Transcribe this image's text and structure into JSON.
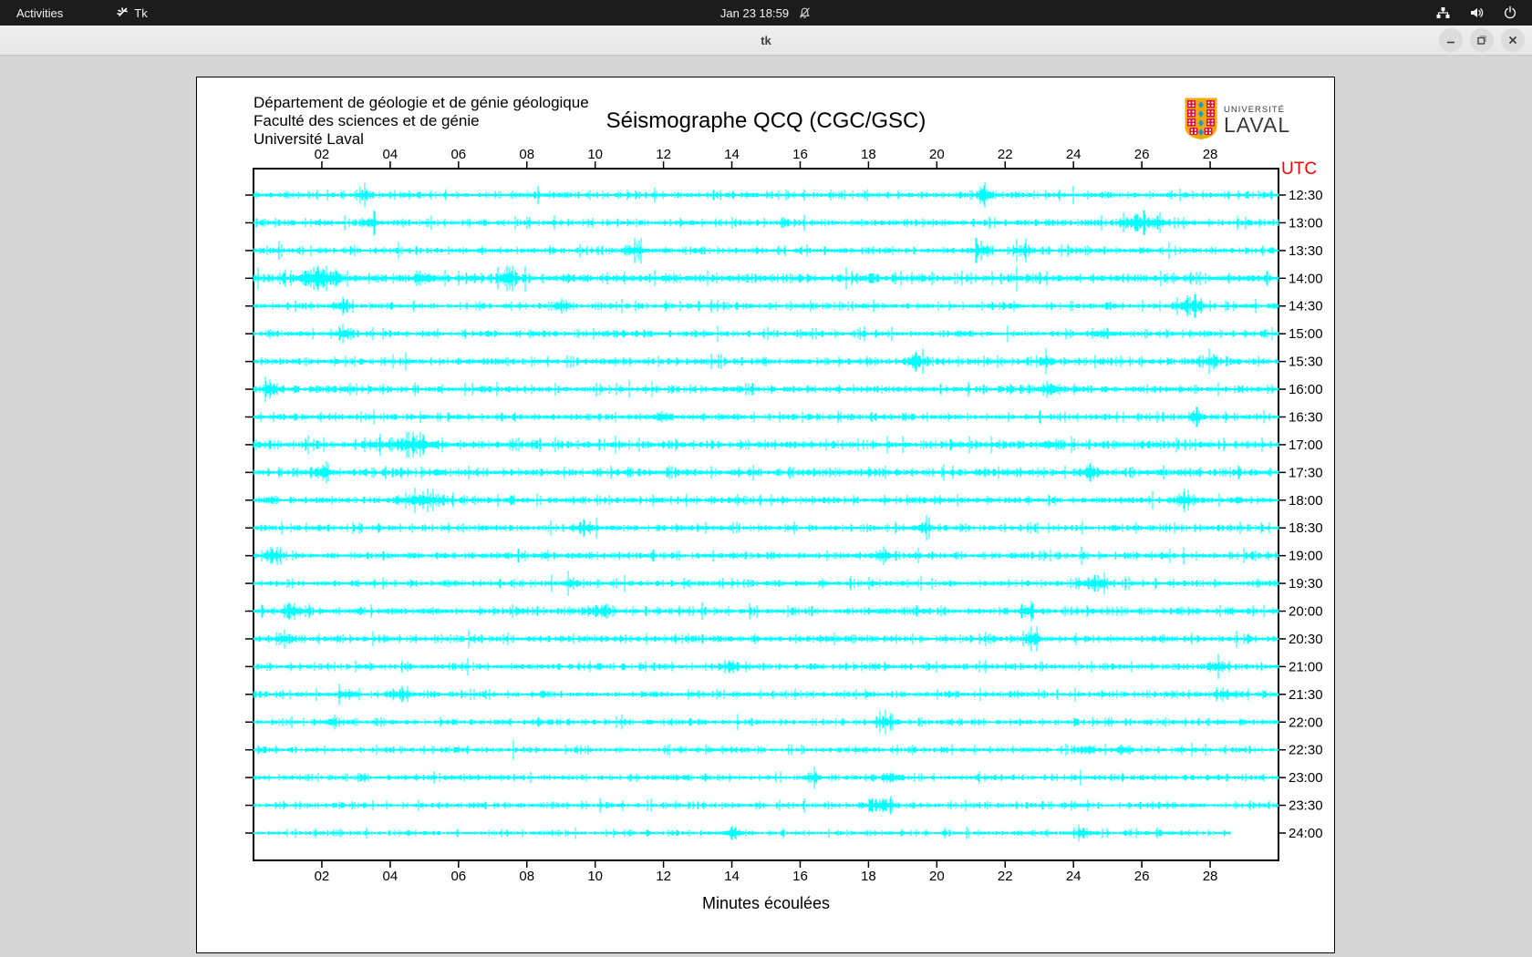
{
  "top_bar": {
    "activities_label": "Activities",
    "app_label": "Tk",
    "clock": "Jan 23 18:59",
    "icons": [
      "tk-feather-icon",
      "bell-muted-icon",
      "network-icon",
      "volume-icon",
      "power-icon"
    ]
  },
  "window": {
    "title": "tk",
    "controls": [
      "minimize",
      "maximize",
      "close"
    ]
  },
  "seismograph": {
    "header_lines": [
      "Département de géologie et de génie géologique",
      "Faculté des sciences et de génie",
      "Université Laval"
    ],
    "title": "Séismographe QCQ (CGC/GSC)",
    "logo": {
      "text_top": "UNIVERSITÉ",
      "text_bottom": "LAVAL"
    },
    "utc_label": "UTC",
    "xlabel": "Minutes écoulées",
    "chart_data": {
      "type": "seismogram",
      "trace_color": "#00ffff",
      "axis_color": "#000000",
      "x_ticks": [
        "02",
        "04",
        "06",
        "08",
        "10",
        "12",
        "14",
        "16",
        "18",
        "20",
        "22",
        "24",
        "26",
        "28"
      ],
      "x_range_minutes": [
        0,
        30
      ],
      "rows": [
        {
          "label": "12:30",
          "end_min": 30,
          "base": 1.0,
          "bursts": [
            {
              "m": 3.2,
              "g": 1.2
            },
            {
              "m": 21.4,
              "g": 3.5,
              "w": 0.18
            }
          ]
        },
        {
          "label": "13:00",
          "end_min": 30,
          "base": 1.0,
          "bursts": [
            {
              "m": 3.4,
              "g": 1.8
            },
            {
              "m": 25.9,
              "g": 2.4,
              "w": 0.35
            },
            {
              "m": 26.5,
              "g": 1.6
            }
          ]
        },
        {
          "label": "13:30",
          "end_min": 30,
          "base": 1.0,
          "bursts": [
            {
              "m": 11.2,
              "g": 2.0
            },
            {
              "m": 21.3,
              "g": 1.7
            },
            {
              "m": 22.5,
              "g": 1.5
            }
          ]
        },
        {
          "label": "14:00",
          "end_min": 30,
          "base": 1.4,
          "bursts": [
            {
              "m": 1.9,
              "g": 2.4,
              "w": 0.5
            },
            {
              "m": 5.0,
              "g": 1.4
            },
            {
              "m": 7.4,
              "g": 1.7
            }
          ]
        },
        {
          "label": "14:30",
          "end_min": 30,
          "base": 1.0,
          "bursts": [
            {
              "m": 2.6,
              "g": 1.5
            },
            {
              "m": 9.0,
              "g": 1.4
            },
            {
              "m": 27.4,
              "g": 2.3,
              "w": 0.4
            }
          ]
        },
        {
          "label": "15:00",
          "end_min": 30,
          "base": 1.0,
          "bursts": [
            {
              "m": 2.6,
              "g": 1.7
            },
            {
              "m": 24.8,
              "g": 1.3
            }
          ]
        },
        {
          "label": "15:30",
          "end_min": 30,
          "base": 1.1,
          "bursts": [
            {
              "m": 19.4,
              "g": 2.1
            },
            {
              "m": 23.2,
              "g": 1.7
            },
            {
              "m": 28.0,
              "g": 1.3
            }
          ]
        },
        {
          "label": "16:00",
          "end_min": 30,
          "base": 1.1,
          "bursts": [
            {
              "m": 0.5,
              "g": 1.4
            },
            {
              "m": 23.4,
              "g": 1.5
            }
          ]
        },
        {
          "label": "16:30",
          "end_min": 30,
          "base": 1.0,
          "bursts": [
            {
              "m": 12.0,
              "g": 1.2
            },
            {
              "m": 27.6,
              "g": 1.7
            }
          ]
        },
        {
          "label": "17:00",
          "end_min": 30,
          "base": 1.3,
          "bursts": [
            {
              "m": 4.5,
              "g": 1.5,
              "w": 0.8
            },
            {
              "m": 23.3,
              "g": 1.4
            }
          ]
        },
        {
          "label": "17:30",
          "end_min": 30,
          "base": 1.2,
          "bursts": [
            {
              "m": 2.0,
              "g": 1.7
            },
            {
              "m": 24.4,
              "g": 1.4
            }
          ]
        },
        {
          "label": "18:00",
          "end_min": 30,
          "base": 1.1,
          "bursts": [
            {
              "m": 5.0,
              "g": 1.8,
              "w": 0.6
            },
            {
              "m": 27.2,
              "g": 1.5
            }
          ]
        },
        {
          "label": "18:30",
          "end_min": 30,
          "base": 1.0,
          "bursts": [
            {
              "m": 9.8,
              "g": 1.2
            },
            {
              "m": 19.6,
              "g": 1.6
            }
          ]
        },
        {
          "label": "19:00",
          "end_min": 30,
          "base": 1.1,
          "bursts": [
            {
              "m": 0.6,
              "g": 1.7
            },
            {
              "m": 18.4,
              "g": 1.5
            }
          ]
        },
        {
          "label": "19:30",
          "end_min": 30,
          "base": 1.0,
          "bursts": [
            {
              "m": 9.3,
              "g": 1.4
            },
            {
              "m": 24.6,
              "g": 2.2,
              "w": 0.3
            }
          ]
        },
        {
          "label": "20:00",
          "end_min": 30,
          "base": 1.1,
          "bursts": [
            {
              "m": 1.2,
              "g": 1.5
            },
            {
              "m": 10.2,
              "g": 1.4
            },
            {
              "m": 22.7,
              "g": 1.4
            }
          ]
        },
        {
          "label": "20:30",
          "end_min": 30,
          "base": 1.1,
          "bursts": [
            {
              "m": 0.9,
              "g": 1.6
            },
            {
              "m": 22.8,
              "g": 1.7
            }
          ]
        },
        {
          "label": "21:00",
          "end_min": 30,
          "base": 1.0,
          "bursts": [
            {
              "m": 14.0,
              "g": 1.2
            },
            {
              "m": 28.2,
              "g": 1.8
            }
          ]
        },
        {
          "label": "21:30",
          "end_min": 30,
          "base": 1.0,
          "bursts": [
            {
              "m": 2.8,
              "g": 1.6
            },
            {
              "m": 4.3,
              "g": 1.5
            },
            {
              "m": 28.4,
              "g": 1.6
            }
          ]
        },
        {
          "label": "22:00",
          "end_min": 30,
          "base": 0.9,
          "bursts": [
            {
              "m": 2.3,
              "g": 1.3
            },
            {
              "m": 18.5,
              "g": 2.2,
              "w": 0.3
            }
          ]
        },
        {
          "label": "22:30",
          "end_min": 30,
          "base": 0.9,
          "bursts": [
            {
              "m": 24.4,
              "g": 1.6
            },
            {
              "m": 25.4,
              "g": 1.4
            }
          ]
        },
        {
          "label": "23:00",
          "end_min": 30,
          "base": 0.9,
          "bursts": [
            {
              "m": 16.4,
              "g": 1.5
            },
            {
              "m": 18.7,
              "g": 1.8
            }
          ]
        },
        {
          "label": "23:30",
          "end_min": 30,
          "base": 0.9,
          "bursts": [
            {
              "m": 18.4,
              "g": 2.1,
              "w": 0.4
            }
          ]
        },
        {
          "label": "24:00",
          "end_min": 28.6,
          "base": 0.8,
          "bursts": [
            {
              "m": 14.0,
              "g": 1.4
            },
            {
              "m": 24.3,
              "g": 1.3
            }
          ]
        }
      ]
    }
  },
  "colors": {
    "topbar_bg": "#1c1c1c",
    "titlebar_bg": "#ebebeb",
    "desktop_bg": "#d6d6d6",
    "trace": "#00ffff",
    "utc_red": "#f40000",
    "logo_red": "#d31245",
    "logo_gold": "#f2a900",
    "logo_blue": "#2196d4"
  }
}
